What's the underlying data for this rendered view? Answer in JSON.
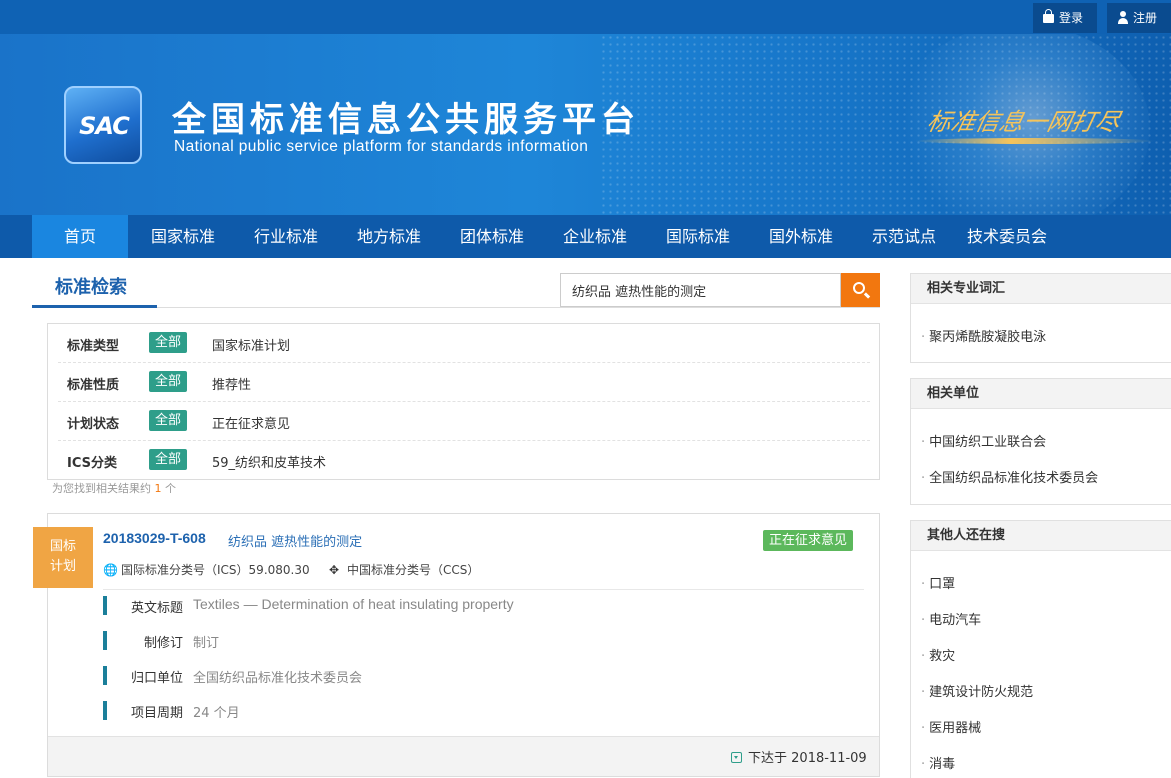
{
  "top": {
    "login_label": "登录",
    "register_label": "注册"
  },
  "banner": {
    "logo_text": "SAC",
    "title": "全国标准信息公共服务平台",
    "subtitle": "National public service platform  for standards information",
    "slogan": "标准信息一网打尽"
  },
  "nav": {
    "items": [
      "首页",
      "国家标准",
      "行业标准",
      "地方标准",
      "团体标准",
      "企业标准",
      "国际标准",
      "国外标准",
      "示范试点",
      "技术委员会"
    ],
    "active_index": 0
  },
  "search": {
    "heading": "标准检索",
    "query": "纺织品 遮热性能的测定",
    "button_icon": "search-icon"
  },
  "filters": [
    {
      "label": "标准类型",
      "all": "全部",
      "value": "国家标准计划"
    },
    {
      "label": "标准性质",
      "all": "全部",
      "value": "推荐性"
    },
    {
      "label": "计划状态",
      "all": "全部",
      "value": "正在征求意见"
    },
    {
      "label": "ICS分类",
      "all": "全部",
      "value": "59_纺织和皮革技术"
    }
  ],
  "result_count": {
    "prefix": "为您找到相关结果约",
    "count": "1",
    "suffix": "个"
  },
  "result": {
    "type_badge_line1": "国标",
    "type_badge_line2": "计划",
    "code": "20183029-T-608",
    "title": "纺织品 遮热性能的测定",
    "status": "正在征求意见",
    "ics_label": "国际标准分类号（ICS）",
    "ics_value": "59.080.30",
    "ccs_label": "中国标准分类号（CCS）",
    "ccs_value": "",
    "details": [
      {
        "label": "英文标题",
        "value": "Textiles — Determination of heat insulating property"
      },
      {
        "label": "制修订",
        "value": "制订"
      },
      {
        "label": "归口单位",
        "value": "全国纺织品标准化技术委员会"
      },
      {
        "label": "项目周期",
        "value": "24 个月"
      }
    ],
    "issued_label": "下达于",
    "issued_date": "2018-11-09"
  },
  "sidebar": {
    "terms_title": "相关专业词汇",
    "terms": [
      "聚丙烯酰胺凝胶电泳"
    ],
    "units_title": "相关单位",
    "units": [
      "中国纺织工业联合会",
      "全国纺织品标准化技术委员会"
    ],
    "others_title": "其他人还在搜",
    "others": [
      "口罩",
      "电动汽车",
      "救灾",
      "建筑设计防火规范",
      "医用器械",
      "消毒"
    ]
  },
  "colors": {
    "nav_bg": "#0e5aaa",
    "nav_active": "#1a86e0",
    "accent_orange": "#f2770f",
    "tag_green": "#2e9e8a",
    "status_green": "#5cb85c",
    "badge_orange": "#f0a544",
    "link_blue": "#1d62ad"
  }
}
